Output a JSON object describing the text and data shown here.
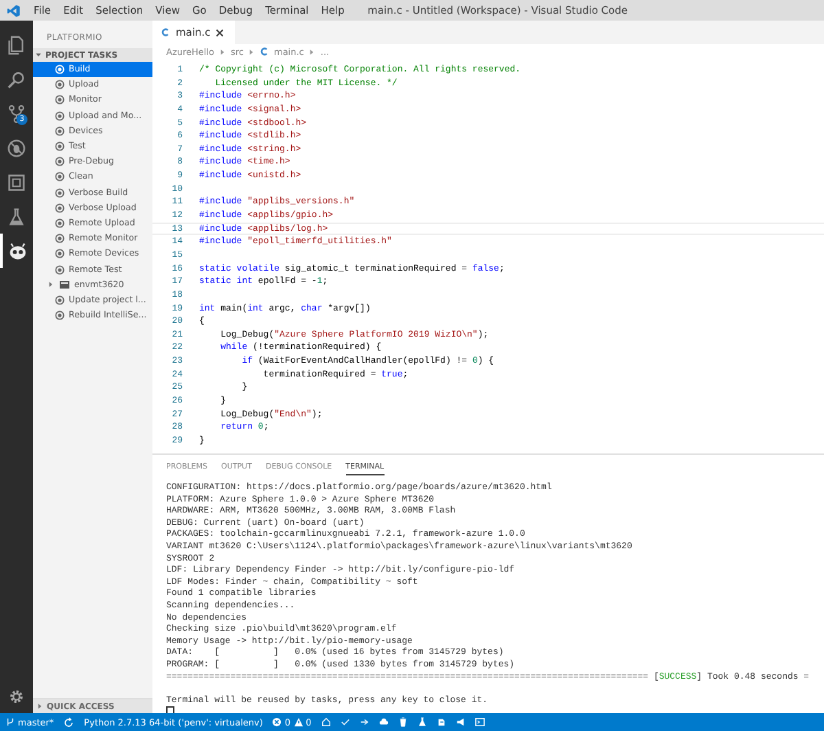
{
  "window": {
    "title": "main.c - Untitled (Workspace) - Visual Studio Code"
  },
  "menu": [
    "File",
    "Edit",
    "Selection",
    "View",
    "Go",
    "Debug",
    "Terminal",
    "Help"
  ],
  "activity_bar": {
    "items": [
      {
        "kind": "files",
        "selected": false
      },
      {
        "kind": "search",
        "selected": false
      },
      {
        "kind": "scm",
        "selected": false,
        "badge": "3"
      },
      {
        "kind": "debug",
        "selected": false
      },
      {
        "kind": "extensions",
        "selected": false
      },
      {
        "kind": "test",
        "selected": false
      },
      {
        "kind": "platformio",
        "selected": true
      }
    ]
  },
  "sidebar": {
    "title": "PLATFORMIO",
    "section": {
      "label": "PROJECT TASKS",
      "expanded": true
    },
    "items": [
      {
        "label": "Build",
        "kind": "task",
        "selected": true
      },
      {
        "label": "Upload",
        "kind": "task",
        "selected": false
      },
      {
        "label": "Monitor",
        "kind": "task",
        "selected": false
      },
      {
        "label": "Upload and Mo...",
        "kind": "task",
        "selected": false
      },
      {
        "label": "Devices",
        "kind": "task",
        "selected": false
      },
      {
        "label": "Test",
        "kind": "task",
        "selected": false
      },
      {
        "label": "Pre-Debug",
        "kind": "task",
        "selected": false
      },
      {
        "label": "Clean",
        "kind": "task",
        "selected": false
      },
      {
        "label": "Verbose Build",
        "kind": "task",
        "selected": false
      },
      {
        "label": "Verbose Upload",
        "kind": "task",
        "selected": false
      },
      {
        "label": "Remote Upload",
        "kind": "task",
        "selected": false
      },
      {
        "label": "Remote Monitor",
        "kind": "task",
        "selected": false
      },
      {
        "label": "Remote Devices",
        "kind": "task",
        "selected": false
      },
      {
        "label": "Remote Test",
        "kind": "task",
        "selected": false
      },
      {
        "label": "envmt3620",
        "kind": "group",
        "selected": false,
        "expanded": false
      },
      {
        "label": "Update project l...",
        "kind": "task",
        "selected": false
      },
      {
        "label": "Rebuild IntelliSe...",
        "kind": "task",
        "selected": false
      }
    ],
    "footer": {
      "label": "QUICK ACCESS",
      "expanded": false
    }
  },
  "editor": {
    "tabs": [
      {
        "label": "main.c",
        "selected": true
      }
    ],
    "breadcrumb": [
      "AzureHello",
      "src",
      "main.c",
      "..."
    ],
    "lines": [
      {
        "n": "1",
        "current": false,
        "tokens": [
          {
            "text": "/* Copyright (c) Microsoft Corporation. All rights reserved.",
            "kind": "comment"
          }
        ]
      },
      {
        "n": "2",
        "current": false,
        "tokens": [
          {
            "text": "   Licensed under the MIT License. */",
            "kind": "comment"
          }
        ]
      },
      {
        "n": "3",
        "current": false,
        "tokens": [
          {
            "text": "#include",
            "kind": "directive"
          },
          {
            "text": " <errno.h>",
            "kind": "string"
          }
        ]
      },
      {
        "n": "4",
        "current": false,
        "tokens": [
          {
            "text": "#include",
            "kind": "directive"
          },
          {
            "text": " <signal.h>",
            "kind": "string"
          }
        ]
      },
      {
        "n": "5",
        "current": false,
        "tokens": [
          {
            "text": "#include",
            "kind": "directive"
          },
          {
            "text": " <stdbool.h>",
            "kind": "string"
          }
        ]
      },
      {
        "n": "6",
        "current": false,
        "tokens": [
          {
            "text": "#include",
            "kind": "directive"
          },
          {
            "text": " <stdlib.h>",
            "kind": "string"
          }
        ]
      },
      {
        "n": "7",
        "current": false,
        "tokens": [
          {
            "text": "#include",
            "kind": "directive"
          },
          {
            "text": " <string.h>",
            "kind": "string"
          }
        ]
      },
      {
        "n": "8",
        "current": false,
        "tokens": [
          {
            "text": "#include",
            "kind": "directive"
          },
          {
            "text": " <time.h>",
            "kind": "string"
          }
        ]
      },
      {
        "n": "9",
        "current": false,
        "tokens": [
          {
            "text": "#include",
            "kind": "directive"
          },
          {
            "text": " <unistd.h>",
            "kind": "string"
          }
        ]
      },
      {
        "n": "10",
        "current": false
      },
      {
        "n": "11",
        "current": false,
        "tokens": [
          {
            "text": "#include",
            "kind": "directive"
          },
          {
            "text": " \"applibs_versions.h\"",
            "kind": "string"
          }
        ]
      },
      {
        "n": "12",
        "current": false,
        "tokens": [
          {
            "text": "#include",
            "kind": "directive"
          },
          {
            "text": " <applibs/gpio.h>",
            "kind": "string"
          }
        ]
      },
      {
        "n": "13",
        "current": true,
        "tokens": [
          {
            "text": "#include",
            "kind": "directive"
          },
          {
            "text": " <applibs/log.h>",
            "kind": "string"
          }
        ]
      },
      {
        "n": "14",
        "current": false,
        "tokens": [
          {
            "text": "#include",
            "kind": "directive"
          },
          {
            "text": " \"epoll_timerfd_utilities.h\"",
            "kind": "string"
          }
        ]
      },
      {
        "n": "15",
        "current": false
      },
      {
        "n": "16",
        "current": false,
        "tokens": [
          {
            "text": "static volatile",
            "kind": "keyword"
          },
          {
            "text": " sig_atomic_t terminationRequired = ",
            "kind": "plain"
          },
          {
            "text": "false",
            "kind": "keyword"
          },
          {
            "text": ";",
            "kind": "plain"
          }
        ]
      },
      {
        "n": "17",
        "current": false,
        "tokens": [
          {
            "text": "static int",
            "kind": "keyword"
          },
          {
            "text": " epollFd = -",
            "kind": "plain"
          },
          {
            "text": "1",
            "kind": "number"
          },
          {
            "text": ";",
            "kind": "plain"
          }
        ]
      },
      {
        "n": "18",
        "current": false
      },
      {
        "n": "19",
        "current": false,
        "tokens": [
          {
            "text": "int",
            "kind": "keyword"
          },
          {
            "text": " main(",
            "kind": "plain"
          },
          {
            "text": "int",
            "kind": "keyword"
          },
          {
            "text": " argc, ",
            "kind": "plain"
          },
          {
            "text": "char",
            "kind": "keyword"
          },
          {
            "text": " *argv[])",
            "kind": "plain"
          }
        ]
      },
      {
        "n": "20",
        "current": false,
        "tokens": [
          {
            "text": "{",
            "kind": "plain"
          }
        ]
      },
      {
        "n": "21",
        "current": false,
        "tokens": [
          {
            "text": "    Log_Debug(",
            "kind": "plain"
          },
          {
            "text": "\"Azure Sphere PlatformIO 2019 WizIO\\n\"",
            "kind": "string"
          },
          {
            "text": ");",
            "kind": "plain"
          }
        ]
      },
      {
        "n": "22",
        "current": false,
        "tokens": [
          {
            "text": "    while",
            "kind": "keyword"
          },
          {
            "text": " (!terminationRequired) {",
            "kind": "plain"
          }
        ]
      },
      {
        "n": "23",
        "current": false,
        "tokens": [
          {
            "text": "        if",
            "kind": "keyword"
          },
          {
            "text": " (WaitForEventAndCallHandler(epollFd) != ",
            "kind": "plain"
          },
          {
            "text": "0",
            "kind": "number"
          },
          {
            "text": ") {",
            "kind": "plain"
          }
        ]
      },
      {
        "n": "24",
        "current": false,
        "tokens": [
          {
            "text": "            terminationRequired = ",
            "kind": "plain"
          },
          {
            "text": "true",
            "kind": "keyword"
          },
          {
            "text": ";",
            "kind": "plain"
          }
        ]
      },
      {
        "n": "25",
        "current": false,
        "tokens": [
          {
            "text": "        }",
            "kind": "plain"
          }
        ]
      },
      {
        "n": "26",
        "current": false,
        "tokens": [
          {
            "text": "    }",
            "kind": "plain"
          }
        ]
      },
      {
        "n": "27",
        "current": false,
        "tokens": [
          {
            "text": "    Log_Debug(",
            "kind": "plain"
          },
          {
            "text": "\"End\\n\"",
            "kind": "string"
          },
          {
            "text": ");",
            "kind": "plain"
          }
        ]
      },
      {
        "n": "28",
        "current": false,
        "tokens": [
          {
            "text": "    return",
            "kind": "keyword"
          },
          {
            "text": " 0",
            "kind": "number"
          },
          {
            "text": ";",
            "kind": "plain"
          }
        ]
      },
      {
        "n": "29",
        "current": false,
        "tokens": [
          {
            "text": "}",
            "kind": "plain"
          }
        ]
      }
    ]
  },
  "panel": {
    "tabs": [
      {
        "label": "PROBLEMS",
        "selected": false
      },
      {
        "label": "OUTPUT",
        "selected": false
      },
      {
        "label": "DEBUG CONSOLE",
        "selected": false
      },
      {
        "label": "TERMINAL",
        "selected": true
      }
    ],
    "terminal": [
      {
        "kind": "text",
        "text": "CONFIGURATION: https://docs.platformio.org/page/boards/azure/mt3620.html"
      },
      {
        "kind": "text",
        "text": "PLATFORM: Azure Sphere 1.0.0 > Azure Sphere MT3620"
      },
      {
        "kind": "text",
        "text": "HARDWARE: ARM, MT3620 500MHz, 3.00MB RAM, 3.00MB Flash"
      },
      {
        "kind": "text",
        "text": "DEBUG: Current (uart) On-board (uart)"
      },
      {
        "kind": "text",
        "text": "PACKAGES: toolchain-gccarmlinuxgnueabi 7.2.1, framework-azure 1.0.0"
      },
      {
        "kind": "text",
        "text": "VARIANT mt3620 C:\\Users\\1124\\.platformio\\packages\\framework-azure\\linux\\variants\\mt3620"
      },
      {
        "kind": "text",
        "text": "SYSROOT 2"
      },
      {
        "kind": "text",
        "text": "LDF: Library Dependency Finder -> http://bit.ly/configure-pio-ldf"
      },
      {
        "kind": "text",
        "text": "LDF Modes: Finder ~ chain, Compatibility ~ soft"
      },
      {
        "kind": "text",
        "text": "Found 1 compatible libraries"
      },
      {
        "kind": "text",
        "text": "Scanning dependencies..."
      },
      {
        "kind": "text",
        "text": "No dependencies"
      },
      {
        "kind": "text",
        "text": "Checking size .pio\\build\\mt3620\\program.elf"
      },
      {
        "kind": "text",
        "text": "Memory Usage -> http://bit.ly/pio-memory-usage"
      },
      {
        "kind": "text",
        "text": "DATA:    [          ]   0.0% (used 16 bytes from 3145729 bytes)"
      },
      {
        "kind": "text",
        "text": "PROGRAM: [          ]   0.0% (used 1330 bytes from 3145729 bytes)"
      },
      {
        "kind": "status",
        "rule": "========================================================================================== [",
        "status": "SUCCESS",
        "tail": "] Took 0.48 seconds ="
      },
      {
        "kind": "blank"
      },
      {
        "kind": "text",
        "text": "Terminal will be reused by tasks, press any key to close it."
      },
      {
        "kind": "cursor"
      }
    ]
  },
  "status_bar": {
    "branch": "master*",
    "python": "Python 2.7.13 64-bit ('penv': virtualenv)",
    "errors": "0",
    "warnings": "0"
  }
}
